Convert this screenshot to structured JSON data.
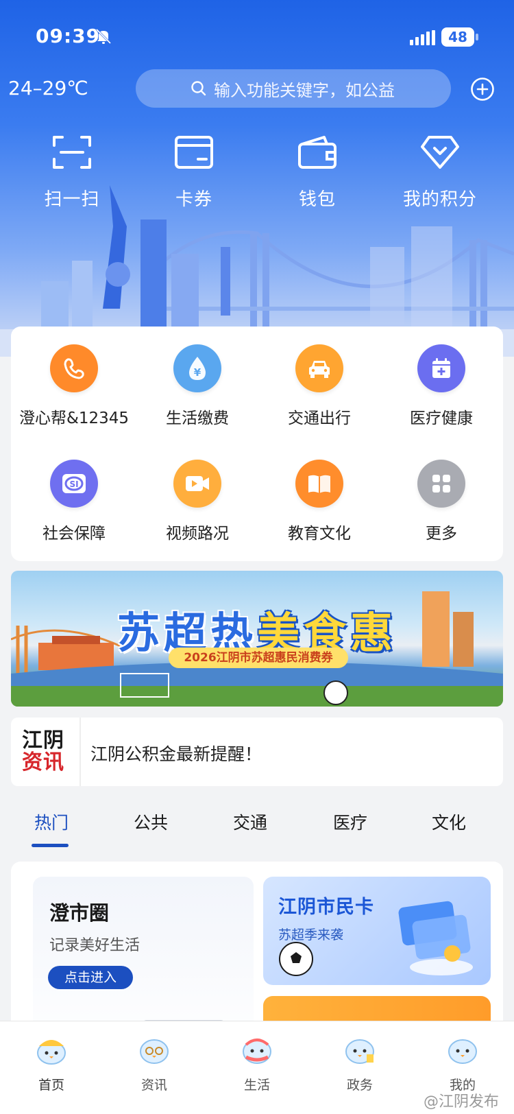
{
  "status_bar": {
    "time": "09:39",
    "battery": "48"
  },
  "header": {
    "weather": "24–29℃",
    "search_placeholder": "输入功能关键字，如公益"
  },
  "quick_actions": [
    {
      "label": "扫一扫",
      "icon": "scan-icon"
    },
    {
      "label": "卡券",
      "icon": "card-icon"
    },
    {
      "label": "钱包",
      "icon": "wallet-icon"
    },
    {
      "label": "我的积分",
      "icon": "diamond-icon"
    }
  ],
  "services": [
    {
      "label": "澄心帮&12345",
      "icon": "phone-icon",
      "color": "#ff8a2a"
    },
    {
      "label": "生活缴费",
      "icon": "yuan-drop-icon",
      "color": "#5aa7ef"
    },
    {
      "label": "交通出行",
      "icon": "car-icon",
      "color": "#ffa531"
    },
    {
      "label": "医疗健康",
      "icon": "medical-calendar-icon",
      "color": "#6b6ef0"
    },
    {
      "label": "社会保障",
      "icon": "social-security-icon",
      "color": "#6f6ff0"
    },
    {
      "label": "视频路况",
      "icon": "video-icon",
      "color": "#ffae3d"
    },
    {
      "label": "教育文化",
      "icon": "book-icon",
      "color": "#ff8d2c"
    },
    {
      "label": "更多",
      "icon": "grid-icon",
      "color": "#a9abb2"
    }
  ],
  "banner": {
    "title_part1": "苏超热",
    "title_part2": "美食惠",
    "subtitle": "2026江阴市苏超惠民消费券"
  },
  "notice": {
    "logo_line1": "江阴",
    "logo_line2": "资讯",
    "text": "江阴公积金最新提醒！"
  },
  "tabs": [
    "热门",
    "公共",
    "交通",
    "医疗",
    "文化"
  ],
  "feed": {
    "left_card": {
      "title": "澄市圈",
      "subtitle": "记录美好生活",
      "button": "点击进入"
    },
    "right_card": {
      "title": "江阴市民卡",
      "subtitle": "苏超季来袭"
    }
  },
  "bottom_nav": [
    "首页",
    "资讯",
    "生活",
    "政务",
    "我的"
  ],
  "watermark": "@江阴发布",
  "colors": {
    "primary": "#1c4fc0",
    "hero_top": "#1f63e6"
  }
}
